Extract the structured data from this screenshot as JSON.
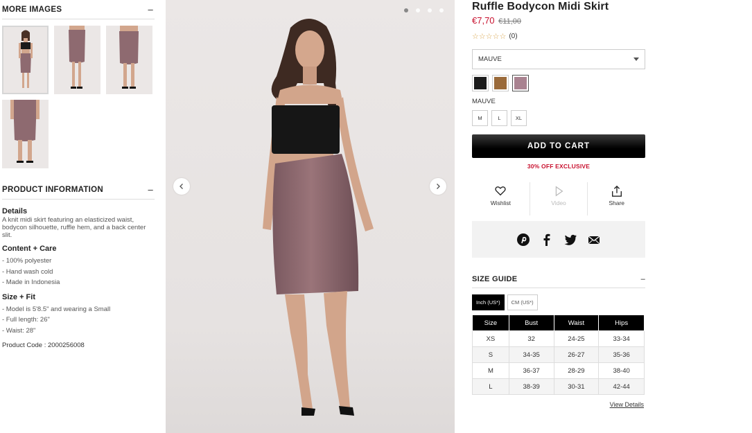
{
  "more_images": {
    "heading": "MORE IMAGES",
    "toggle": "–",
    "thumbnails": [
      "front",
      "side",
      "back",
      "detail"
    ]
  },
  "product_information": {
    "heading": "PRODUCT INFORMATION",
    "toggle": "–",
    "details_title": "Details",
    "details_text": "A knit midi skirt featuring an elasticized waist, bodycon silhouette, ruffle hem, and a back center slit.",
    "content_title": "Content + Care",
    "content_items": [
      "- 100% polyester",
      "- Hand wash cold",
      "- Made in Indonesia"
    ],
    "size_title": "Size + Fit",
    "size_items": [
      "- Model is 5'8.5\" and wearing a Small",
      "- Full length: 26\"",
      "- Waist: 28\""
    ],
    "product_code": "Product Code : 2000256008"
  },
  "gallery": {
    "dot_count": 4,
    "active_dot": 0
  },
  "product": {
    "title": "Ruffle Bodycon Midi Skirt",
    "sale_price": "€7,70",
    "original_price": "€11,00",
    "stars": "☆☆☆☆☆",
    "review_count": "(0)",
    "color_select": "MAUVE",
    "swatches": [
      {
        "name": "black",
        "color": "#1c1c1c"
      },
      {
        "name": "brown",
        "color": "#9a6a3a"
      },
      {
        "name": "mauve",
        "color": "#a98290"
      }
    ],
    "selected_color": "MAUVE",
    "sizes": [
      "M",
      "L",
      "XL"
    ],
    "add_to_cart": "ADD TO CART",
    "promo": "30% OFF EXCLUSIVE"
  },
  "actions": {
    "wishlist": "Wishlist",
    "video": "Video",
    "share": "Share"
  },
  "size_guide": {
    "heading": "SIZE GUIDE",
    "toggle": "–",
    "unit_inch": "Inch (US*)",
    "unit_cm": "CM (US*)",
    "columns": [
      "Size",
      "Bust",
      "Waist",
      "Hips"
    ],
    "rows": [
      [
        "XS",
        "32",
        "24-25",
        "33-34"
      ],
      [
        "S",
        "34-35",
        "26-27",
        "35-36"
      ],
      [
        "M",
        "36-37",
        "28-29",
        "38-40"
      ],
      [
        "L",
        "38-39",
        "30-31",
        "42-44"
      ]
    ],
    "view_details": "View Details"
  },
  "colors": {
    "sale_red": "#c8102e",
    "skirt": "#8e6a70",
    "background": "#e8e4e3"
  }
}
